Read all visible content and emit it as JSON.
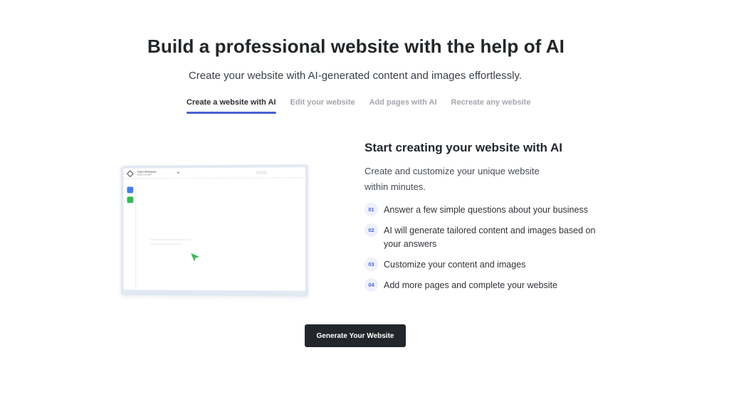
{
  "hero": {
    "title": "Build a professional website with the help of AI",
    "subtitle": "Create your website with AI-generated content and images effortlessly."
  },
  "tabs": [
    {
      "label": "Create a website with AI",
      "active": true
    },
    {
      "label": "Edit your website",
      "active": false
    },
    {
      "label": "Add pages with AI",
      "active": false
    },
    {
      "label": "Recreate any website",
      "active": false
    }
  ],
  "preview": {
    "workspace_name": "Tupe's Workspace",
    "workspace_sub": "Static Domain",
    "cursor_icon": "pointer-arrow-icon",
    "cursor_color": "#3bb55a"
  },
  "section": {
    "title": "Start creating your website with AI",
    "description": "Create and customize your unique website within minutes.",
    "steps": [
      {
        "num": "01",
        "text": "Answer a few simple questions about your business"
      },
      {
        "num": "02",
        "text": "AI will generate tailored content and images based on your answers"
      },
      {
        "num": "03",
        "text": "Customize your content and images"
      },
      {
        "num": "04",
        "text": "Add more pages and complete your website"
      }
    ]
  },
  "cta": {
    "label": "Generate Your Website"
  },
  "colors": {
    "accent": "#4a5fd1",
    "button_bg": "#23272b"
  }
}
